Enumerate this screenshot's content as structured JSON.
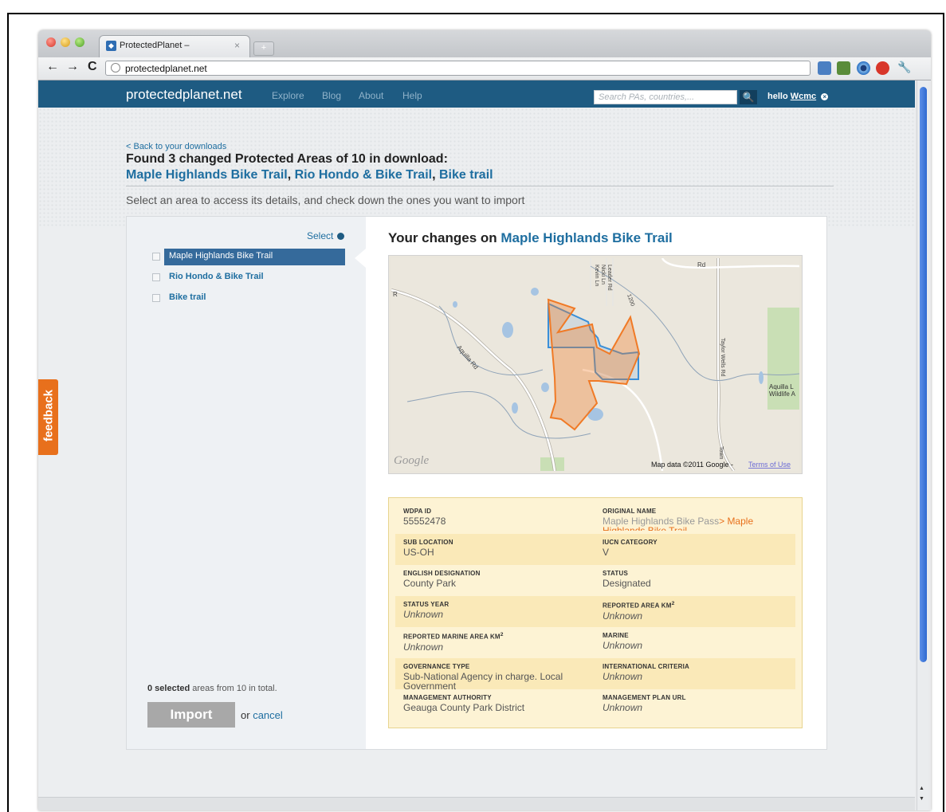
{
  "browser": {
    "tab_title": "ProtectedPlanet –",
    "tab_close": "×",
    "new_tab": "+",
    "url": "protectedplanet.net",
    "nav": {
      "back": "←",
      "forward": "→",
      "reload": "C"
    },
    "ext_icons": [
      "translate-icon",
      "evernote-icon",
      "eye-icon",
      "adblock-icon",
      "wrench-icon"
    ],
    "ext_wrench": "🔧"
  },
  "site": {
    "logo": "protectedplanet.net",
    "nav": [
      "Explore",
      "Blog",
      "About",
      "Help"
    ],
    "search_placeholder": "Search PAs, countries,...",
    "search_icon": "🔍",
    "hello_prefix": "hello",
    "user": "Wcmc",
    "user_close": "×",
    "colors": {
      "header": "#1e5b82",
      "link": "#1e6ea0",
      "accent": "#e8701c",
      "new_polygon": "#f07a26",
      "old_polygon": "#3a8fd8"
    }
  },
  "page": {
    "back_link": "< Back to your downloads",
    "heading": "Found 3 changed Protected Areas of 10 in download:",
    "changed_areas": [
      "Maple Highlands Bike Trail",
      "Rio Hondo & Bike Trail",
      "Bike trail"
    ],
    "separator": ",",
    "instructions": "Select an area to access its details, and check down the ones you want to import"
  },
  "sidebar": {
    "select_label": "Select",
    "items": [
      {
        "label": "Maple Highlands Bike Trail",
        "active": true,
        "checked": false
      },
      {
        "label": "Rio Hondo & Bike Trail",
        "active": false,
        "checked": false
      },
      {
        "label": "Bike trail",
        "active": false,
        "checked": false
      }
    ],
    "summary_count": "0 selected",
    "summary_rest": " areas from 10 in total.",
    "import_label": "Import",
    "or_label": "or",
    "cancel_label": "cancel"
  },
  "detail": {
    "title_prefix": "Your changes on",
    "title_area": "Maple Highlands Bike Trail",
    "map": {
      "labels": {
        "aquilla_rd": "Aquilla Rd",
        "aquilla_lake": "Aquilla L",
        "wildlife": "Wildlife A",
        "taylor_wells": "Taylor Wells Rd",
        "leader_rd": "Leader Rd",
        "nicki_ln": "Nicki Ln",
        "kevin_ln": "Kevin Ln",
        "rd": "Rd",
        "r": "R",
        "n200": "1200",
        "town": "Town"
      },
      "google_logo": "Google",
      "attribution": "Map data ©2011 Google -",
      "terms": "Terms of Use"
    },
    "fields": [
      {
        "key": "WDPA ID",
        "value": "55552478"
      },
      {
        "key": "ORIGINAL NAME",
        "old": "Maple Highlands Bike Pass",
        "arrow": ">",
        "new": "Maple Highlands Bike Trail"
      },
      {
        "key": "SUB LOCATION",
        "value": "US-OH"
      },
      {
        "key": "IUCN CATEGORY",
        "value": "V"
      },
      {
        "key": "ENGLISH DESIGNATION",
        "value": "County Park"
      },
      {
        "key": "STATUS",
        "value": "Designated"
      },
      {
        "key": "STATUS YEAR",
        "value": "Unknown"
      },
      {
        "key": "REPORTED AREA KM",
        "sup": "2",
        "value": "Unknown"
      },
      {
        "key": "REPORTED MARINE AREA KM",
        "sup": "2",
        "value": "Unknown"
      },
      {
        "key": "MARINE",
        "value": "Unknown"
      },
      {
        "key": "GOVERNANCE TYPE",
        "value": "Sub-National Agency in charge. Local Government"
      },
      {
        "key": "INTERNATIONAL CRITERIA",
        "value": "Unknown"
      },
      {
        "key": "MANAGEMENT AUTHORITY",
        "value": "Geauga County Park District"
      },
      {
        "key": "MANAGEMENT PLAN URL",
        "value": "Unknown"
      }
    ]
  },
  "feedback_label": "feedback",
  "scroll": {
    "up": "▲",
    "down": "▼"
  }
}
